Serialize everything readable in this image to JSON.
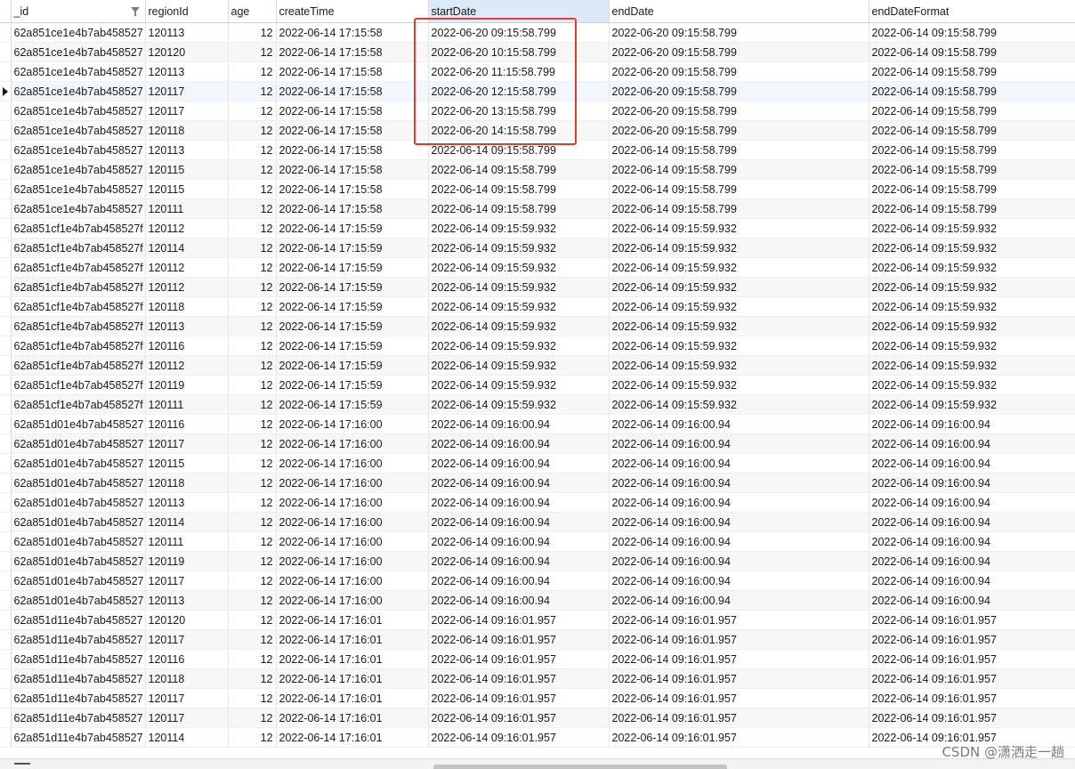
{
  "columns": [
    "_id",
    "regionId",
    "age",
    "createTime",
    "startDate",
    "endDate",
    "endDateFormat"
  ],
  "active_column": "startDate",
  "selected_row_index": 3,
  "rows": [
    [
      "62a851ce1e4b7ab458527",
      "120113",
      "12",
      "2022-06-14 17:15:58",
      "2022-06-20 09:15:58.799",
      "2022-06-20 09:15:58.799",
      "2022-06-14 09:15:58.799"
    ],
    [
      "62a851ce1e4b7ab458527",
      "120120",
      "12",
      "2022-06-14 17:15:58",
      "2022-06-20 10:15:58.799",
      "2022-06-20 09:15:58.799",
      "2022-06-14 09:15:58.799"
    ],
    [
      "62a851ce1e4b7ab458527",
      "120113",
      "12",
      "2022-06-14 17:15:58",
      "2022-06-20 11:15:58.799",
      "2022-06-20 09:15:58.799",
      "2022-06-14 09:15:58.799"
    ],
    [
      "62a851ce1e4b7ab458527",
      "120117",
      "12",
      "2022-06-14 17:15:58",
      "2022-06-20 12:15:58.799",
      "2022-06-20 09:15:58.799",
      "2022-06-14 09:15:58.799"
    ],
    [
      "62a851ce1e4b7ab458527",
      "120117",
      "12",
      "2022-06-14 17:15:58",
      "2022-06-20 13:15:58.799",
      "2022-06-20 09:15:58.799",
      "2022-06-14 09:15:58.799"
    ],
    [
      "62a851ce1e4b7ab458527",
      "120118",
      "12",
      "2022-06-14 17:15:58",
      "2022-06-20 14:15:58.799",
      "2022-06-20 09:15:58.799",
      "2022-06-14 09:15:58.799"
    ],
    [
      "62a851ce1e4b7ab458527",
      "120113",
      "12",
      "2022-06-14 17:15:58",
      "2022-06-14 09:15:58.799",
      "2022-06-14 09:15:58.799",
      "2022-06-14 09:15:58.799"
    ],
    [
      "62a851ce1e4b7ab458527",
      "120115",
      "12",
      "2022-06-14 17:15:58",
      "2022-06-14 09:15:58.799",
      "2022-06-14 09:15:58.799",
      "2022-06-14 09:15:58.799"
    ],
    [
      "62a851ce1e4b7ab458527",
      "120115",
      "12",
      "2022-06-14 17:15:58",
      "2022-06-14 09:15:58.799",
      "2022-06-14 09:15:58.799",
      "2022-06-14 09:15:58.799"
    ],
    [
      "62a851ce1e4b7ab458527",
      "120111",
      "12",
      "2022-06-14 17:15:58",
      "2022-06-14 09:15:58.799",
      "2022-06-14 09:15:58.799",
      "2022-06-14 09:15:58.799"
    ],
    [
      "62a851cf1e4b7ab458527f",
      "120112",
      "12",
      "2022-06-14 17:15:59",
      "2022-06-14 09:15:59.932",
      "2022-06-14 09:15:59.932",
      "2022-06-14 09:15:59.932"
    ],
    [
      "62a851cf1e4b7ab458527f",
      "120114",
      "12",
      "2022-06-14 17:15:59",
      "2022-06-14 09:15:59.932",
      "2022-06-14 09:15:59.932",
      "2022-06-14 09:15:59.932"
    ],
    [
      "62a851cf1e4b7ab458527f",
      "120112",
      "12",
      "2022-06-14 17:15:59",
      "2022-06-14 09:15:59.932",
      "2022-06-14 09:15:59.932",
      "2022-06-14 09:15:59.932"
    ],
    [
      "62a851cf1e4b7ab458527f",
      "120112",
      "12",
      "2022-06-14 17:15:59",
      "2022-06-14 09:15:59.932",
      "2022-06-14 09:15:59.932",
      "2022-06-14 09:15:59.932"
    ],
    [
      "62a851cf1e4b7ab458527f",
      "120118",
      "12",
      "2022-06-14 17:15:59",
      "2022-06-14 09:15:59.932",
      "2022-06-14 09:15:59.932",
      "2022-06-14 09:15:59.932"
    ],
    [
      "62a851cf1e4b7ab458527f",
      "120113",
      "12",
      "2022-06-14 17:15:59",
      "2022-06-14 09:15:59.932",
      "2022-06-14 09:15:59.932",
      "2022-06-14 09:15:59.932"
    ],
    [
      "62a851cf1e4b7ab458527f",
      "120116",
      "12",
      "2022-06-14 17:15:59",
      "2022-06-14 09:15:59.932",
      "2022-06-14 09:15:59.932",
      "2022-06-14 09:15:59.932"
    ],
    [
      "62a851cf1e4b7ab458527f",
      "120112",
      "12",
      "2022-06-14 17:15:59",
      "2022-06-14 09:15:59.932",
      "2022-06-14 09:15:59.932",
      "2022-06-14 09:15:59.932"
    ],
    [
      "62a851cf1e4b7ab458527f",
      "120119",
      "12",
      "2022-06-14 17:15:59",
      "2022-06-14 09:15:59.932",
      "2022-06-14 09:15:59.932",
      "2022-06-14 09:15:59.932"
    ],
    [
      "62a851cf1e4b7ab458527f",
      "120111",
      "12",
      "2022-06-14 17:15:59",
      "2022-06-14 09:15:59.932",
      "2022-06-14 09:15:59.932",
      "2022-06-14 09:15:59.932"
    ],
    [
      "62a851d01e4b7ab458527",
      "120116",
      "12",
      "2022-06-14 17:16:00",
      "2022-06-14 09:16:00.94",
      "2022-06-14 09:16:00.94",
      "2022-06-14 09:16:00.94"
    ],
    [
      "62a851d01e4b7ab458527",
      "120117",
      "12",
      "2022-06-14 17:16:00",
      "2022-06-14 09:16:00.94",
      "2022-06-14 09:16:00.94",
      "2022-06-14 09:16:00.94"
    ],
    [
      "62a851d01e4b7ab458527",
      "120115",
      "12",
      "2022-06-14 17:16:00",
      "2022-06-14 09:16:00.94",
      "2022-06-14 09:16:00.94",
      "2022-06-14 09:16:00.94"
    ],
    [
      "62a851d01e4b7ab458527",
      "120118",
      "12",
      "2022-06-14 17:16:00",
      "2022-06-14 09:16:00.94",
      "2022-06-14 09:16:00.94",
      "2022-06-14 09:16:00.94"
    ],
    [
      "62a851d01e4b7ab458527",
      "120113",
      "12",
      "2022-06-14 17:16:00",
      "2022-06-14 09:16:00.94",
      "2022-06-14 09:16:00.94",
      "2022-06-14 09:16:00.94"
    ],
    [
      "62a851d01e4b7ab458527",
      "120114",
      "12",
      "2022-06-14 17:16:00",
      "2022-06-14 09:16:00.94",
      "2022-06-14 09:16:00.94",
      "2022-06-14 09:16:00.94"
    ],
    [
      "62a851d01e4b7ab458527",
      "120111",
      "12",
      "2022-06-14 17:16:00",
      "2022-06-14 09:16:00.94",
      "2022-06-14 09:16:00.94",
      "2022-06-14 09:16:00.94"
    ],
    [
      "62a851d01e4b7ab458527",
      "120119",
      "12",
      "2022-06-14 17:16:00",
      "2022-06-14 09:16:00.94",
      "2022-06-14 09:16:00.94",
      "2022-06-14 09:16:00.94"
    ],
    [
      "62a851d01e4b7ab458527",
      "120117",
      "12",
      "2022-06-14 17:16:00",
      "2022-06-14 09:16:00.94",
      "2022-06-14 09:16:00.94",
      "2022-06-14 09:16:00.94"
    ],
    [
      "62a851d01e4b7ab458527",
      "120113",
      "12",
      "2022-06-14 17:16:00",
      "2022-06-14 09:16:00.94",
      "2022-06-14 09:16:00.94",
      "2022-06-14 09:16:00.94"
    ],
    [
      "62a851d11e4b7ab458527",
      "120120",
      "12",
      "2022-06-14 17:16:01",
      "2022-06-14 09:16:01.957",
      "2022-06-14 09:16:01.957",
      "2022-06-14 09:16:01.957"
    ],
    [
      "62a851d11e4b7ab458527",
      "120117",
      "12",
      "2022-06-14 17:16:01",
      "2022-06-14 09:16:01.957",
      "2022-06-14 09:16:01.957",
      "2022-06-14 09:16:01.957"
    ],
    [
      "62a851d11e4b7ab458527",
      "120116",
      "12",
      "2022-06-14 17:16:01",
      "2022-06-14 09:16:01.957",
      "2022-06-14 09:16:01.957",
      "2022-06-14 09:16:01.957"
    ],
    [
      "62a851d11e4b7ab458527",
      "120118",
      "12",
      "2022-06-14 17:16:01",
      "2022-06-14 09:16:01.957",
      "2022-06-14 09:16:01.957",
      "2022-06-14 09:16:01.957"
    ],
    [
      "62a851d11e4b7ab458527",
      "120117",
      "12",
      "2022-06-14 17:16:01",
      "2022-06-14 09:16:01.957",
      "2022-06-14 09:16:01.957",
      "2022-06-14 09:16:01.957"
    ],
    [
      "62a851d11e4b7ab458527",
      "120117",
      "12",
      "2022-06-14 17:16:01",
      "2022-06-14 09:16:01.957",
      "2022-06-14 09:16:01.957",
      "2022-06-14 09:16:01.957"
    ],
    [
      "62a851d11e4b7ab458527",
      "120114",
      "12",
      "2022-06-14 17:16:01",
      "2022-06-14 09:16:01.957",
      "2022-06-14 09:16:01.957",
      "2022-06-14 09:16:01.957"
    ]
  ],
  "watermark": "CSDN @潇洒走一趟",
  "colors": {
    "highlight_box": "#e53935",
    "active_header": "#dce9f7",
    "selected_row": "#f2f7fd"
  },
  "icons": {
    "filter": "filter-icon",
    "row_pointer": "row-pointer-icon"
  }
}
